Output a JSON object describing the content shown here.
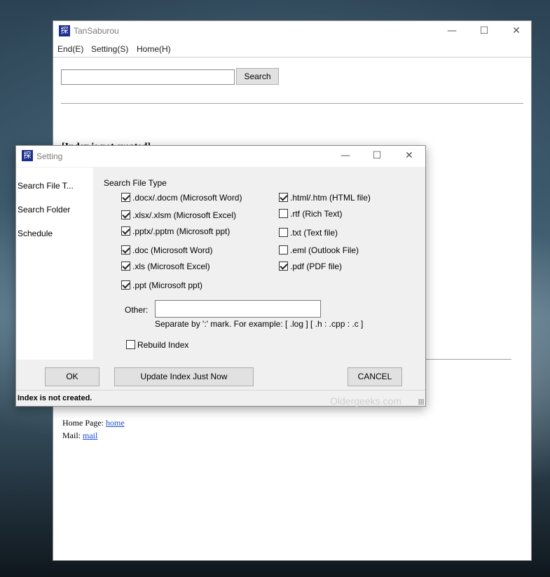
{
  "main_window": {
    "title": "TanSaburou",
    "icon_glyph": "探",
    "controls": {
      "minimize": "—",
      "maximize": "☐",
      "close": "✕"
    },
    "menu": [
      "End(E)",
      "Setting(S)",
      "Home(H)"
    ],
    "search": {
      "value": "",
      "button_label": "Search"
    },
    "hidden_heading": "[Index is not created]",
    "home_page_label": "Home Page:",
    "home_link": "home",
    "mail_label": "Mail:",
    "mail_link": "mail"
  },
  "setting_dialog": {
    "title": "Setting",
    "icon_glyph": "探",
    "controls": {
      "minimize": "—",
      "maximize": "☐",
      "close": "✕"
    },
    "sidebar": [
      "Search File T...",
      "Search Folder",
      "Schedule"
    ],
    "section_title": "Search File Type",
    "file_types_left": [
      {
        "label": ".docx/.docm (Microsoft Word)",
        "checked": true
      },
      {
        "label": ".xlsx/.xlsm (Microsoft Excel)",
        "checked": true
      },
      {
        "label": ".pptx/.pptm (Microsoft ppt)",
        "checked": true
      },
      {
        "label": ".doc (Microsoft Word)",
        "checked": true
      },
      {
        "label": ".xls (Microsoft Excel)",
        "checked": true
      },
      {
        "label": ".ppt (Microsoft ppt)",
        "checked": true
      }
    ],
    "file_types_right": [
      {
        "label": ".html/.htm (HTML file)",
        "checked": true
      },
      {
        "label": ".rtf (Rich Text)",
        "checked": false
      },
      {
        "label": ".txt (Text file)",
        "checked": false
      },
      {
        "label": ".eml (Outlook File)",
        "checked": false
      },
      {
        "label": ".pdf (PDF file)",
        "checked": true
      }
    ],
    "other_label": "Other:",
    "other_value": "",
    "other_hint": "Separate by ':' mark. For example: [ .log ] [ .h : .cpp : .c ]",
    "rebuild_index": {
      "label": "Rebuild Index",
      "checked": false
    },
    "buttons": {
      "ok": "OK",
      "update": "Update Index Just Now",
      "cancel": "CANCEL"
    },
    "status": "Index is not created.",
    "watermark": "Oldergeeks.com"
  }
}
